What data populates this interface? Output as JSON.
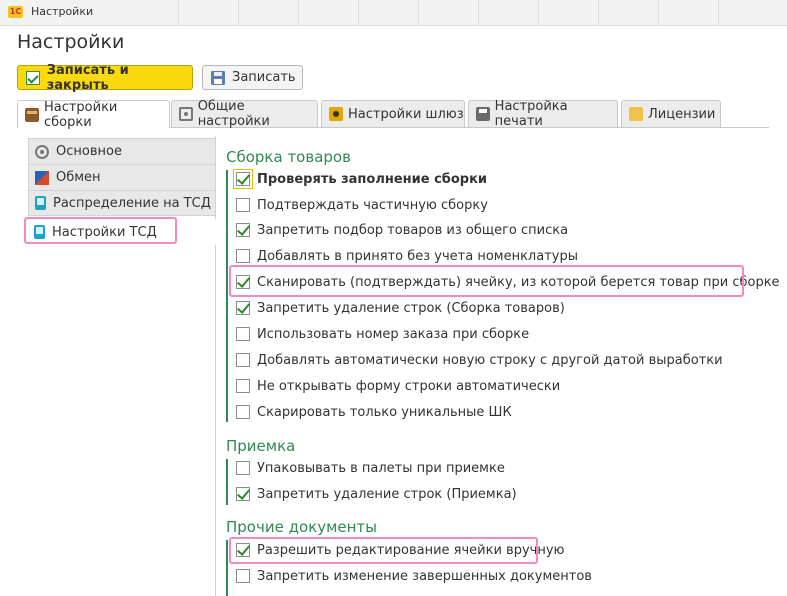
{
  "window": {
    "logo": "1С",
    "title": "Настройки"
  },
  "form": {
    "title": "Настройки"
  },
  "toolbar": {
    "save_close_label": "Записать и закрыть",
    "save_label": "Записать"
  },
  "tabs": [
    {
      "label": "Настройки сборки",
      "icon": "box-icon",
      "active": true
    },
    {
      "label": "Общие настройки",
      "icon": "gear-icon"
    },
    {
      "label": "Настройки шлюз",
      "icon": "gateway-icon"
    },
    {
      "label": "Настройка печати",
      "icon": "printer-icon"
    },
    {
      "label": "Лицензии",
      "icon": "license-icon"
    }
  ],
  "sidebar": {
    "items": [
      {
        "label": "Основное",
        "icon": "gear-icon"
      },
      {
        "label": "Обмен",
        "icon": "exchange-icon"
      },
      {
        "label": "Распределение на ТСД",
        "icon": "phone-icon"
      },
      {
        "label": "Настройки ТСД",
        "icon": "phone-icon",
        "active": true
      }
    ]
  },
  "groups": {
    "assembly": {
      "title": "Сборка товаров",
      "items": [
        {
          "label": "Проверять заполнение сборки",
          "checked": true
        },
        {
          "label": "Подтверждать частичную сборку",
          "checked": false
        },
        {
          "label": "Запретить подбор товаров из общего списка",
          "checked": true
        },
        {
          "label": "Добавлять в принято без учета номенклатуры",
          "checked": false
        },
        {
          "label": "Сканировать (подтверждать) ячейку, из которой берется товар при сборке",
          "checked": true
        },
        {
          "label": "Запретить удаление строк (Сборка товаров)",
          "checked": true
        },
        {
          "label": "Использовать номер заказа при сборке",
          "checked": false
        },
        {
          "label": "Добавлять автоматически новую строку с другой датой выработки",
          "checked": false
        },
        {
          "label": "Не открывать форму строки автоматически",
          "checked": false
        },
        {
          "label": "Скарировать только уникальные ШК",
          "checked": false
        }
      ]
    },
    "receiving": {
      "title": "Приемка",
      "items": [
        {
          "label": "Упаковывать в палеты при приемке",
          "checked": false
        },
        {
          "label": "Запретить удаление строк (Приемка)",
          "checked": true
        }
      ]
    },
    "other": {
      "title": "Прочие документы",
      "items": [
        {
          "label": "Разрешить редактирование ячейки вручную",
          "checked": true
        },
        {
          "label": "Запретить изменение завершенных документов",
          "checked": false
        }
      ]
    }
  }
}
